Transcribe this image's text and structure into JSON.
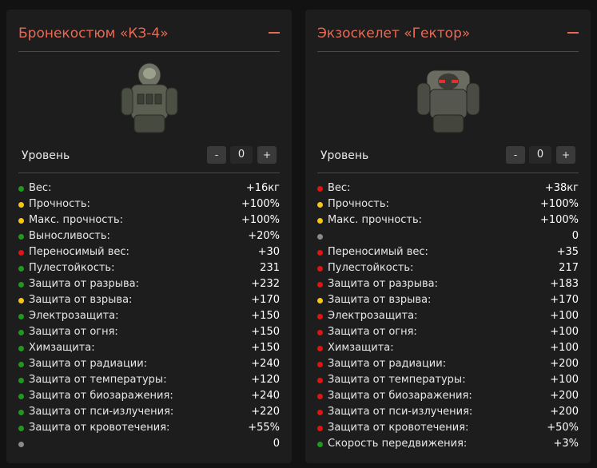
{
  "colors": {
    "accent": "#e86a55",
    "good": "#1f9a1f",
    "neutral": "#f5c518",
    "bad": "#e01414",
    "none": "#8a8a8a"
  },
  "left": {
    "title": "Бронекостюм «КЗ-4»",
    "collapse_icon": "minus-icon",
    "level_label": "Уровень",
    "level_value": "0",
    "minus_label": "-",
    "plus_label": "+",
    "stats": [
      {
        "name": "Вес:",
        "value": "+16кг",
        "status": "good"
      },
      {
        "name": "Прочность:",
        "value": "+100%",
        "status": "neutral"
      },
      {
        "name": "Макс. прочность:",
        "value": "+100%",
        "status": "neutral"
      },
      {
        "name": "Выносливость:",
        "value": "+20%",
        "status": "good"
      },
      {
        "name": "Переносимый вес:",
        "value": "+30",
        "status": "bad"
      },
      {
        "name": "Пулестойкость:",
        "value": "231",
        "status": "good"
      },
      {
        "name": "Защита от разрыва:",
        "value": "+232",
        "status": "good"
      },
      {
        "name": "Защита от взрыва:",
        "value": "+170",
        "status": "neutral"
      },
      {
        "name": "Электрозащита:",
        "value": "+150",
        "status": "good"
      },
      {
        "name": "Защита от огня:",
        "value": "+150",
        "status": "good"
      },
      {
        "name": "Химзащита:",
        "value": "+150",
        "status": "good"
      },
      {
        "name": "Защита от радиации:",
        "value": "+240",
        "status": "good"
      },
      {
        "name": "Защита от температуры:",
        "value": "+120",
        "status": "good"
      },
      {
        "name": "Защита от биозаражения:",
        "value": "+240",
        "status": "good"
      },
      {
        "name": "Защита от пси-излучения:",
        "value": "+220",
        "status": "good"
      },
      {
        "name": "Защита от кровотечения:",
        "value": "+55%",
        "status": "good"
      },
      {
        "name": "",
        "value": "0",
        "status": "none"
      }
    ]
  },
  "right": {
    "title": "Экзоскелет «Гектор»",
    "collapse_icon": "minus-icon",
    "level_label": "Уровень",
    "level_value": "0",
    "minus_label": "-",
    "plus_label": "+",
    "stats": [
      {
        "name": "Вес:",
        "value": "+38кг",
        "status": "bad"
      },
      {
        "name": "Прочность:",
        "value": "+100%",
        "status": "neutral"
      },
      {
        "name": "Макс. прочность:",
        "value": "+100%",
        "status": "neutral"
      },
      {
        "name": "",
        "value": "0",
        "status": "none"
      },
      {
        "name": "Переносимый вес:",
        "value": "+35",
        "status": "bad"
      },
      {
        "name": "Пулестойкость:",
        "value": "217",
        "status": "bad"
      },
      {
        "name": "Защита от разрыва:",
        "value": "+183",
        "status": "bad"
      },
      {
        "name": "Защита от взрыва:",
        "value": "+170",
        "status": "neutral"
      },
      {
        "name": "Электрозащита:",
        "value": "+100",
        "status": "bad"
      },
      {
        "name": "Защита от огня:",
        "value": "+100",
        "status": "bad"
      },
      {
        "name": "Химзащита:",
        "value": "+100",
        "status": "bad"
      },
      {
        "name": "Защита от радиации:",
        "value": "+200",
        "status": "bad"
      },
      {
        "name": "Защита от температуры:",
        "value": "+100",
        "status": "bad"
      },
      {
        "name": "Защита от биозаражения:",
        "value": "+200",
        "status": "bad"
      },
      {
        "name": "Защита от пси-излучения:",
        "value": "+200",
        "status": "bad"
      },
      {
        "name": "Защита от кровотечения:",
        "value": "+50%",
        "status": "bad"
      },
      {
        "name": "Скорость передвижения:",
        "value": "+3%",
        "status": "good"
      }
    ]
  }
}
